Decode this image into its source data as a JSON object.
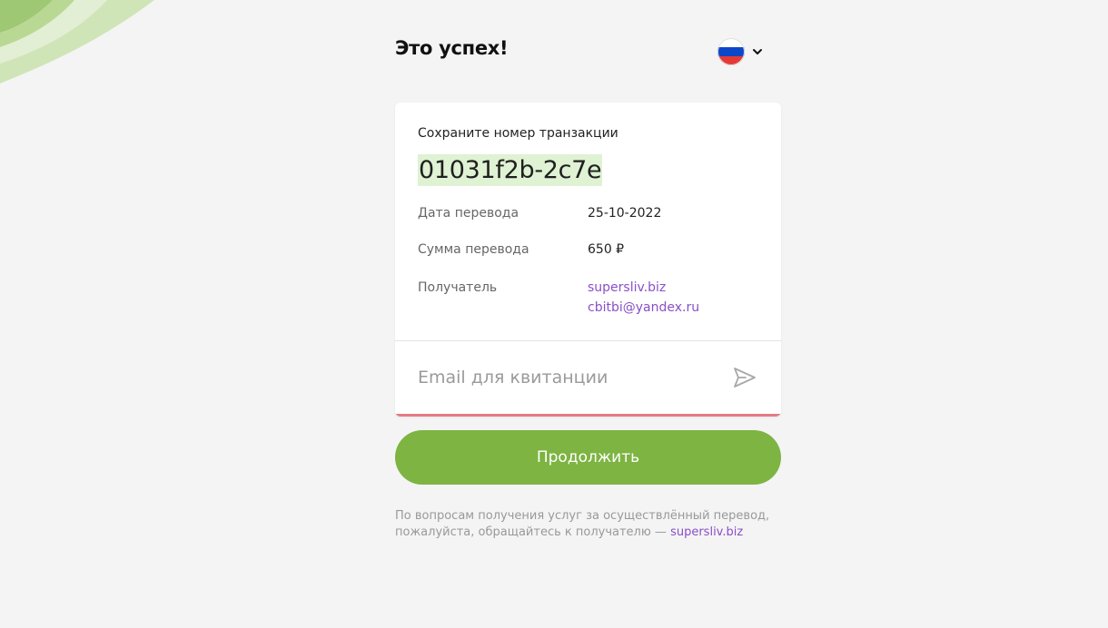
{
  "header": {
    "title": "Это успех!"
  },
  "language": {
    "flag": "russia-flag",
    "colors": [
      "#ffffff",
      "#0d47c9",
      "#e53935"
    ]
  },
  "card": {
    "save_label": "Сохраните номер транзакции",
    "transaction_id": "01031f2b-2c7e",
    "rows": [
      {
        "label": "Дата перевода",
        "value": "25-10-2022"
      },
      {
        "label": "Сумма перевода",
        "value": "650 ₽"
      },
      {
        "label": "Получатель",
        "value": "supersliv.biz",
        "value2": "cbitbi@yandex.ru"
      }
    ],
    "email_placeholder": "Email для квитанции"
  },
  "continue_label": "Продолжить",
  "footer": {
    "note": "По вопросам получения услуг за осуществлённый перевод, пожалуйста, обращайтесь к получателю —",
    "link": "supersliv.biz"
  },
  "colors": {
    "accent": "#7db442",
    "link": "#8a4fc8",
    "highlight": "#dff2d3",
    "error": "#e57a84"
  }
}
